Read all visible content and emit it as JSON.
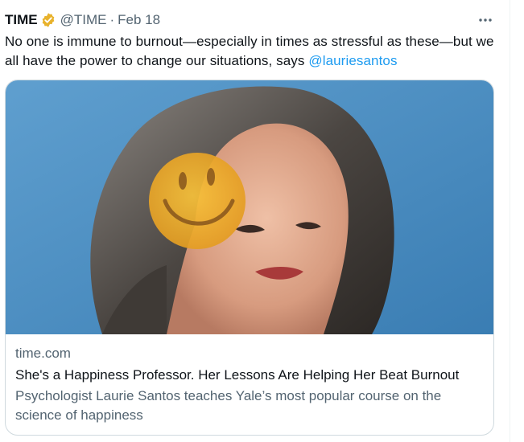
{
  "tweet": {
    "author_name": "TIME",
    "handle": "@TIME",
    "separator": "·",
    "date": "Feb 18",
    "text_before": "No one is immune to burnout—especially in times as stressful as these—but we all have the power to change our situations, says ",
    "mention": "@lauriesantos",
    "verified_color": "#e8b22c"
  },
  "card": {
    "domain": "time.com",
    "headline": "She's a Happiness Professor. Her Lessons Are Helping Her Beat Burnout",
    "description": "Psychologist Laurie Santos teaches Yale’s most popular course on the science of happiness"
  },
  "colors": {
    "text": "#0f1419",
    "secondary": "#536471",
    "accent": "#1d9bf0",
    "border": "#cfd9de"
  }
}
